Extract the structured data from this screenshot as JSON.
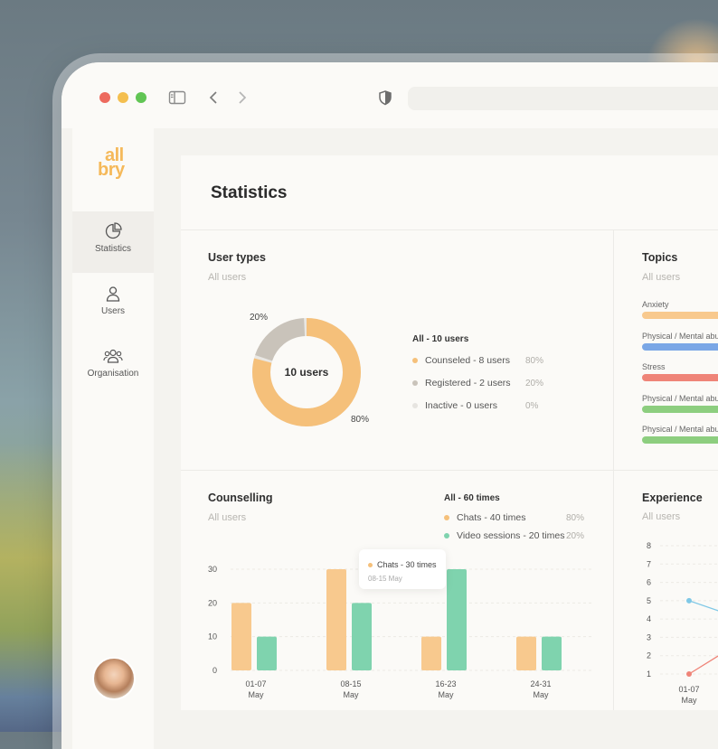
{
  "colors": {
    "orange": "#f8c98e",
    "orange_dot": "#f5c07a",
    "teal": "#7fd3ae",
    "grey": "#c9c3ba",
    "light_grey": "#e6e4e0",
    "blue": "#7aa7e6",
    "red": "#ef8478",
    "green": "#8dce7f"
  },
  "sidebar": {
    "logo_line1": "all",
    "logo_line2": "bry",
    "items": [
      {
        "label": "Statistics",
        "icon": "pie-chart-icon"
      },
      {
        "label": "Users",
        "icon": "user-icon"
      },
      {
        "label": "Organisation",
        "icon": "users-group-icon"
      }
    ]
  },
  "page": {
    "title": "Statistics"
  },
  "user_types": {
    "title": "User types",
    "subtitle": "All users",
    "center_label": "10 users",
    "pct_top": "20%",
    "pct_bottom": "80%",
    "legend_head": "All - 10 users",
    "legend": [
      {
        "label": "Counseled - 8 users",
        "pct": "80%",
        "color": "#f5c07a"
      },
      {
        "label": "Registered - 2 users",
        "pct": "20%",
        "color": "#c9c3ba"
      },
      {
        "label": "Inactive - 0 users",
        "pct": "0%",
        "color": "#e6e4e0"
      }
    ],
    "chart_data": {
      "type": "pie",
      "values": [
        8,
        2,
        0
      ],
      "categories": [
        "Counseled",
        "Registered",
        "Inactive"
      ]
    }
  },
  "topics": {
    "title": "Topics",
    "subtitle": "All users",
    "items": [
      {
        "label": "Anxiety",
        "color": "#f8c98e"
      },
      {
        "label": "Physical / Mental abu",
        "color": "#7aa7e6"
      },
      {
        "label": "Stress",
        "color": "#ef8478"
      },
      {
        "label": "Physical / Mental abu",
        "color": "#8dce7f"
      },
      {
        "label": "Physical / Mental abu",
        "color": "#8dce7f"
      }
    ]
  },
  "counselling": {
    "title": "Counselling",
    "subtitle": "All users",
    "legend_head": "All - 60 times",
    "legend": [
      {
        "label": "Chats - 40 times",
        "pct": "80%",
        "color": "#f5c07a"
      },
      {
        "label": "Video sessions - 20 times",
        "pct": "20%",
        "color": "#7fd3ae"
      }
    ],
    "tooltip": {
      "title": "Chats - 30 times",
      "sub": "08-15 May"
    },
    "chart_data": {
      "type": "bar",
      "categories": [
        "01-07",
        "08-15",
        "16-23",
        "24-31"
      ],
      "category_sub": "May",
      "ylim": [
        0,
        30
      ],
      "yticks": [
        0,
        10,
        20,
        30
      ],
      "series": [
        {
          "name": "Chats",
          "values": [
            20,
            30,
            10,
            10
          ],
          "color": "#f8c98e"
        },
        {
          "name": "Video sessions",
          "values": [
            10,
            20,
            30,
            10
          ],
          "color": "#7fd3ae"
        }
      ]
    }
  },
  "experience": {
    "title": "Experience",
    "subtitle": "All users",
    "chart_data": {
      "type": "line",
      "x": [
        "01-07"
      ],
      "x_sub": "May",
      "ylim": [
        1,
        8
      ],
      "yticks": [
        1,
        2,
        3,
        4,
        5,
        6,
        7,
        8
      ],
      "series": [
        {
          "values": [
            5
          ],
          "color": "#7fc8e6"
        },
        {
          "values": [
            1
          ],
          "color": "#ef8478"
        }
      ]
    }
  }
}
